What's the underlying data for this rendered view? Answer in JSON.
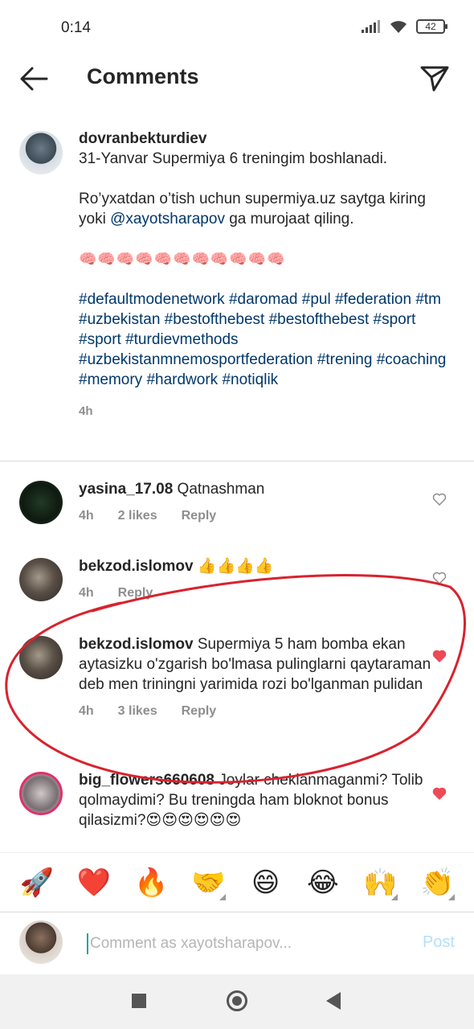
{
  "status_bar": {
    "time": "0:14",
    "battery": "42"
  },
  "header": {
    "title": "Comments"
  },
  "post": {
    "username": "dovranbekturdiev",
    "text_line1": "31-Yanvar Supermiya 6 treningim boshlanadi.",
    "text_para2_start": "Ro’yxatdan o’tish uchun supermiya.uz saytga kiring yoki ",
    "mention": "@xayotsharapov",
    "text_para2_end": " ga murojaat qiling.",
    "brains": "🧠🧠🧠🧠🧠🧠🧠🧠🧠🧠🧠",
    "hashtags": "#defaultmodenetwork #daromad #pul #federation #tm #uzbekistan #bestofthebest #bestofthebest #sport #sport #turdievmethods #uzbekistanmnemosportfederation #trening #coaching #memory #hardwork #notiqlik",
    "time": "4h"
  },
  "comments": [
    {
      "username": "yasina_17.08",
      "text": "Qatnashman",
      "time": "4h",
      "likes": "2 likes",
      "reply": "Reply",
      "liked": false
    },
    {
      "username": "bekzod.islomov",
      "text": "👍👍👍👍",
      "time": "4h",
      "likes": "",
      "reply": "Reply",
      "liked": false
    },
    {
      "username": "bekzod.islomov",
      "text": "Supermiya 5 ham bomba ekan aytasizku o'zgarish bo'lmasa pulinglarni qaytaraman deb men triningni yarimida rozi bo'lganman pulidan",
      "time": "4h",
      "likes": "3 likes",
      "reply": "Reply",
      "liked": true
    },
    {
      "username": "big_flowers660608",
      "text": "Joylar cheklanmaganmi? Tolib qolmaydimi? Bu treningda ham bloknot bonus qilasizmi?😍😍😍😍😍😍",
      "liked": true
    }
  ],
  "emoji_bar": [
    "🚀",
    "❤️",
    "🔥",
    "🤝",
    "😄",
    "😂",
    "🙌",
    "👏"
  ],
  "input": {
    "placeholder": "Comment as xayotsharapov...",
    "post_label": "Post"
  },
  "colors": {
    "link": "#00376b",
    "like_red": "#ed4956",
    "annotation_red": "#d8232e",
    "post_disabled": "#b2dffc"
  }
}
